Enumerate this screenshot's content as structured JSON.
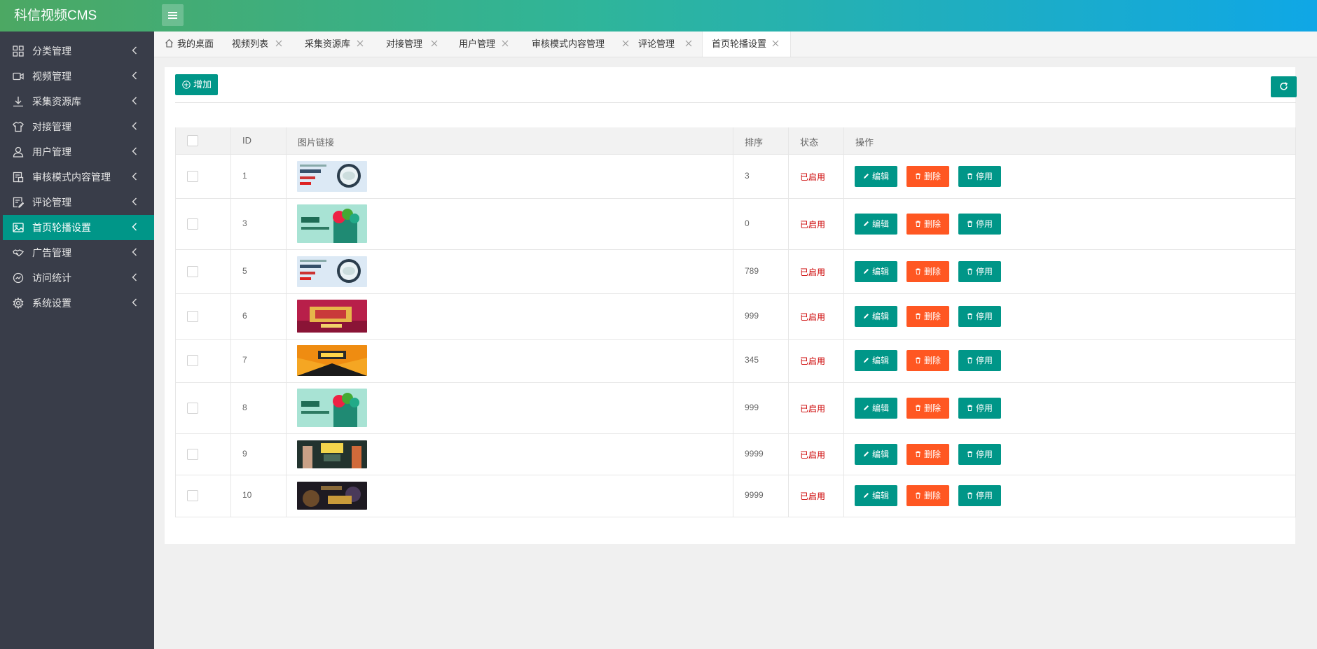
{
  "app": {
    "title": "科信视频CMS"
  },
  "sidebar": {
    "items": [
      {
        "label": "分类管理",
        "icon": "grid-icon"
      },
      {
        "label": "视频管理",
        "icon": "video-camera-icon"
      },
      {
        "label": "采集资源库",
        "icon": "download-icon"
      },
      {
        "label": "对接管理",
        "icon": "shirt-icon"
      },
      {
        "label": "用户管理",
        "icon": "user-icon"
      },
      {
        "label": "审核模式内容管理",
        "icon": "document-icon"
      },
      {
        "label": "评论管理",
        "icon": "comment-edit-icon"
      },
      {
        "label": "首页轮播设置",
        "icon": "image-icon",
        "active": true
      },
      {
        "label": "广告管理",
        "icon": "handshake-icon"
      },
      {
        "label": "访问统计",
        "icon": "chart-circle-icon"
      },
      {
        "label": "系统设置",
        "icon": "gear-icon"
      }
    ]
  },
  "tabs": [
    {
      "label": "我的桌面",
      "home": true
    },
    {
      "label": "视频列表"
    },
    {
      "label": "采集资源库"
    },
    {
      "label": "对接管理"
    },
    {
      "label": "用户管理"
    },
    {
      "label": "审核模式内容管理"
    },
    {
      "label": "评论管理"
    },
    {
      "label": "首页轮播设置",
      "active": true
    }
  ],
  "toolbar": {
    "add_label": "增加"
  },
  "table": {
    "headers": {
      "id": "ID",
      "image": "图片链接",
      "sort": "排序",
      "status": "状态",
      "ops": "操作"
    },
    "rows": [
      {
        "id": "1",
        "sort": "3",
        "status": "已启用",
        "thumb": "food-banner"
      },
      {
        "id": "3",
        "sort": "0",
        "status": "已启用",
        "thumb": "veg-banner"
      },
      {
        "id": "5",
        "sort": "789",
        "status": "已启用",
        "thumb": "food-banner"
      },
      {
        "id": "6",
        "sort": "999",
        "status": "已启用",
        "thumb": "red-banner"
      },
      {
        "id": "7",
        "sort": "345",
        "status": "已启用",
        "thumb": "orange-banner"
      },
      {
        "id": "8",
        "sort": "999",
        "status": "已启用",
        "thumb": "veg-banner"
      },
      {
        "id": "9",
        "sort": "9999",
        "status": "已启用",
        "thumb": "people-banner"
      },
      {
        "id": "10",
        "sort": "9999",
        "status": "已启用",
        "thumb": "dark-banner"
      }
    ],
    "actions": {
      "edit": "编辑",
      "delete": "删除",
      "disable": "停用"
    }
  },
  "colors": {
    "primary": "#009688",
    "danger": "#ff5722",
    "sidebar": "#393d49",
    "status": "#cc0000"
  }
}
